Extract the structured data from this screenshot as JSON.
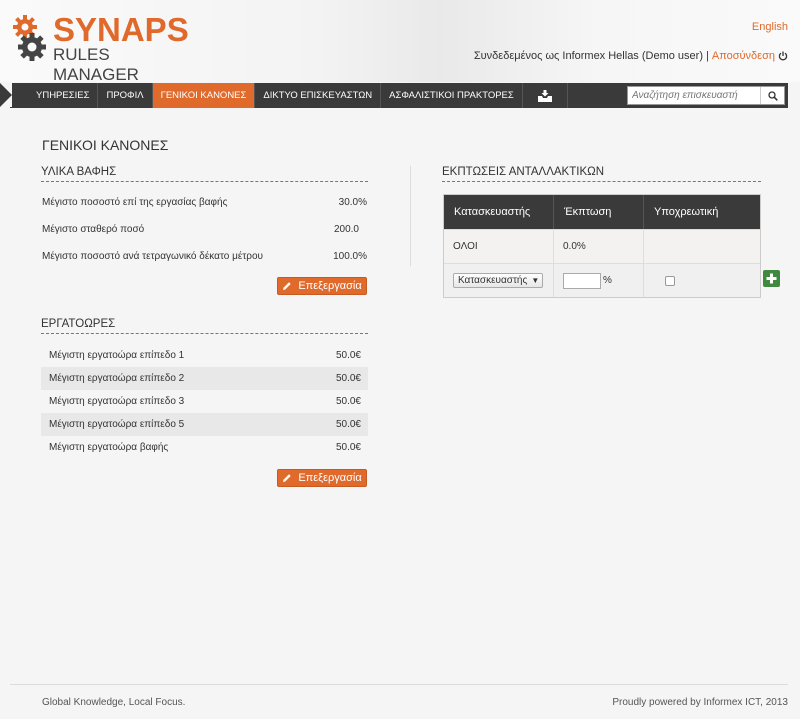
{
  "header": {
    "brand": "SYNAPS",
    "subtitle": "RULES MANAGER",
    "language": "English",
    "logged_in_text": "Συνδεδεμένος ως Informex Hellas (Demo user)",
    "separator": "|",
    "logout": "Αποσύνδεση"
  },
  "nav": {
    "items": [
      {
        "label": "ΥΠΗΡΕΣΙΕΣ"
      },
      {
        "label": "ΠΡΟΦΙΛ"
      },
      {
        "label": "ΓΕΝΙΚΟΙ ΚΑΝΟΝΕΣ"
      },
      {
        "label": "ΔΙΚΤΥΟ ΕΠΙΣΚΕΥΑΣΤΩΝ"
      },
      {
        "label": "ΑΣΦΑΛΙΣΤΙΚΟΙ ΠΡΑΚΤΟΡΕΣ"
      }
    ],
    "active_index": 2,
    "inbox_icon": "inbox-download-icon",
    "search_placeholder": "Αναζήτηση επισκευαστή",
    "search_icon": "search-icon"
  },
  "page": {
    "title": "ΓΕΝΙΚΟΙ ΚΑΝΟΝΕΣ"
  },
  "paint_materials": {
    "title": "ΥΛΙΚΑ ΒΑΦΗΣ",
    "rows": [
      {
        "label": "Μέγιστο ποσοστό επί της εργασίας βαφής",
        "value": "30.0%"
      },
      {
        "label": "Μέγιστο σταθερό ποσό",
        "value": "200.0"
      },
      {
        "label": "Μέγιστο ποσοστό ανά τετραγωνικό δέκατο μέτρου",
        "value": "100.0%"
      }
    ],
    "edit_label": "Επεξεργασία"
  },
  "labor_hours": {
    "title": "ΕΡΓΑΤΟΩΡΕΣ",
    "rows": [
      {
        "label": "Μέγιστη εργατοώρα επίπεδο 1",
        "value": "50.0€"
      },
      {
        "label": "Μέγιστη εργατοώρα επίπεδο 2",
        "value": "50.0€"
      },
      {
        "label": "Μέγιστη εργατοώρα επίπεδο 3",
        "value": "50.0€"
      },
      {
        "label": "Μέγιστη εργατοώρα επίπεδο 5",
        "value": "50.0€"
      },
      {
        "label": "Μέγιστη εργατοώρα βαφής",
        "value": "50.0€"
      }
    ],
    "edit_label": "Επεξεργασία"
  },
  "parts_discounts": {
    "title": "ΕΚΠΤΩΣΕΙΣ ΑΝΤΑΛΛΑΚΤΙΚΩΝ",
    "columns": [
      "Κατασκευαστής",
      "Έκπτωση",
      "Υποχρεωτική"
    ],
    "rows": [
      {
        "manufacturer": "ΟΛΟΙ",
        "discount": "0.0%",
        "mandatory": ""
      }
    ],
    "form": {
      "select_value": "Κατασκευαστής",
      "discount_value": "",
      "percent_suffix": "%",
      "mandatory_checked": false
    }
  },
  "footer": {
    "left": "Global Knowledge, Local Focus.",
    "right": "Proudly powered by Informex ICT, 2013"
  },
  "colors": {
    "accent": "#e06a2c",
    "navbar": "#3a3a3a",
    "add_button": "#3f8a3f"
  }
}
